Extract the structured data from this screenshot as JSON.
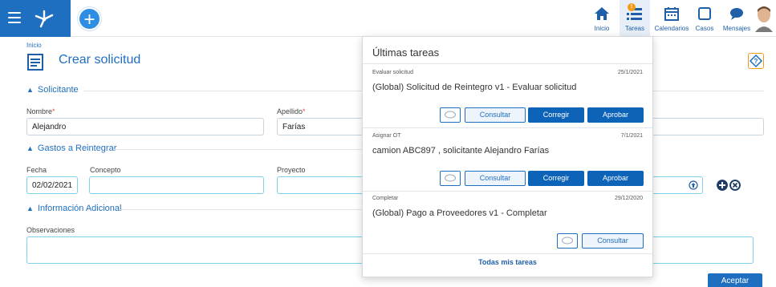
{
  "header": {
    "icons": {
      "menu": "hamburger-icon",
      "logo": "nodes-logo",
      "add": "plus-icon"
    },
    "nav": [
      {
        "label": "Inicio",
        "icon": "home-icon"
      },
      {
        "label": "Tareas",
        "icon": "tasks-icon",
        "badge": "!"
      },
      {
        "label": "Calendarios",
        "icon": "calendar-icon"
      },
      {
        "label": "Casos",
        "icon": "square-icon"
      },
      {
        "label": "Mensajes",
        "icon": "chat-icon"
      }
    ],
    "add_symbol": "+"
  },
  "breadcrumb": "Inicio",
  "page_title": "Crear solicitud",
  "sections": {
    "solicitante": "Solicitante",
    "gastos": "Gastos a Reintegrar",
    "info": "Información Adicional"
  },
  "fields": {
    "nombre_label": "Nombre",
    "nombre_value": "Alejandro",
    "apellido_label": "Apellido",
    "apellido_value": "Farías",
    "required_mark": "*",
    "fecha_label": "Fecha",
    "fecha_value": "02/02/2021",
    "concepto_label": "Concepto",
    "proyecto_label": "Proyecto",
    "observaciones_label": "Observaciones"
  },
  "accept_label": "Aceptar",
  "popup": {
    "title": "Últimas tareas",
    "tasks": [
      {
        "category": "Evaluar solicitud",
        "date": "25/1/2021",
        "name": "(Global) Solicitud de Reintegro v1 - Evaluar solicitud",
        "consult": "Consultar",
        "correct": "Corregir",
        "approve": "Aprobar"
      },
      {
        "category": "Asignar OT",
        "date": "7/1/2021",
        "name": "camion ABC897 , solicitante Alejandro Farías",
        "consult": "Consultar",
        "correct": "Corregir",
        "approve": "Aprobar"
      },
      {
        "category": "Completar",
        "date": "29/12/2020",
        "name": "(Global) Pago a Proveedores v1 - Completar",
        "consult": "Consultar"
      }
    ],
    "all_tasks": "Todas mis tareas"
  },
  "colors": {
    "primary": "#1f6fc1",
    "accent": "#f39c12",
    "input_focus": "#7fd0ea"
  }
}
